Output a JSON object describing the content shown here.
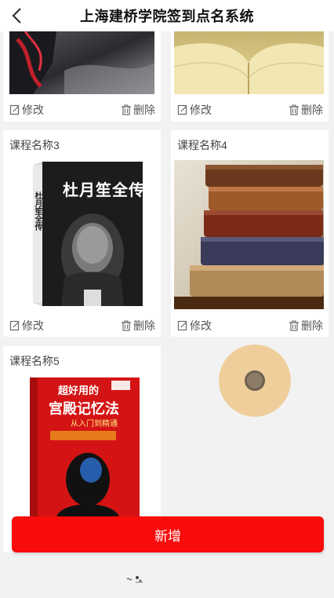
{
  "header": {
    "title": "上海建桥学院签到点名系统"
  },
  "actions": {
    "edit_label": "修改",
    "delete_label": "删除"
  },
  "courses": [
    {
      "name": "",
      "image": "dark-figure-photo"
    },
    {
      "name": "",
      "image": "open-book-photo"
    },
    {
      "name": "课程名称3",
      "image": "book-cover-du-yuesheng"
    },
    {
      "name": "课程名称4",
      "image": "stacked-old-books-photo"
    },
    {
      "name": "课程名称5",
      "image": "book-cover-memory-palace"
    }
  ],
  "book3": {
    "title": "杜月笙全传",
    "spine": "杜月笙全传"
  },
  "book5": {
    "title_top": "超好用的",
    "title_main": "宫殿记忆法",
    "subtitle": "从入门到精通"
  },
  "add_button": {
    "label": "新增"
  },
  "colors": {
    "accent": "#f80c0c",
    "fab": "#eec88c"
  }
}
